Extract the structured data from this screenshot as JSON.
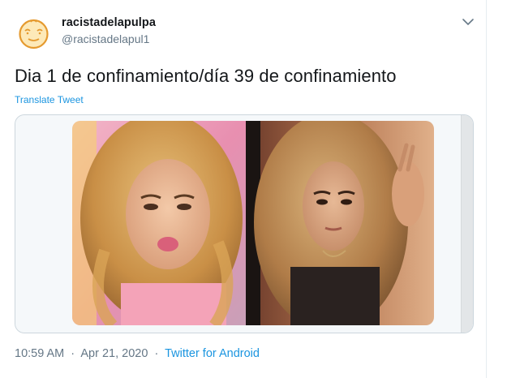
{
  "tweet": {
    "author": {
      "display_name": "racistadelapulpa",
      "handle": "@racistadelapul1",
      "avatar_icon": "cartoon-face-icon"
    },
    "text": "Dia 1 de confinamiento/día 39 de confinamiento",
    "translate_label": "Translate Tweet",
    "media": {
      "left_photo": "photo-before",
      "right_photo": "photo-after"
    },
    "meta": {
      "time": "10:59 AM",
      "date": "Apr 21, 2020",
      "separator": "·",
      "source": "Twitter for Android"
    }
  },
  "colors": {
    "text_primary": "#14171a",
    "text_secondary": "#657786",
    "link": "#1b95e0",
    "border": "#ccd6dd"
  }
}
